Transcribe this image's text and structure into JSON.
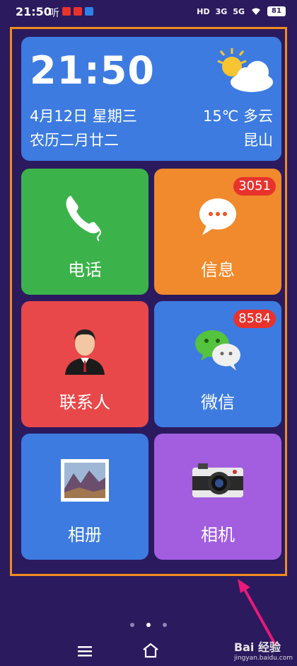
{
  "status_bar": {
    "time": "21:50",
    "app_label": "听",
    "net1": "HD",
    "net2": "3G",
    "net3": "5G",
    "battery": "81"
  },
  "widget": {
    "clock": "21:50",
    "date": "4月12日 星期三",
    "lunar": "农历二月廿二",
    "weather": "15℃ 多云",
    "city": "昆山",
    "weather_icon": "partly-cloudy-icon"
  },
  "tiles": [
    {
      "label": "电话",
      "icon": "phone-icon"
    },
    {
      "label": "信息",
      "icon": "message-icon",
      "badge": "3051"
    },
    {
      "label": "联系人",
      "icon": "contact-icon"
    },
    {
      "label": "微信",
      "icon": "wechat-icon",
      "badge": "8584"
    },
    {
      "label": "相册",
      "icon": "photo-album-icon"
    },
    {
      "label": "相机",
      "icon": "camera-icon"
    }
  ],
  "pager": {
    "count": 3,
    "active_index": 1
  },
  "watermark": {
    "brand": "Bai 经验",
    "url": "jingyan.baidu.com"
  },
  "colors": {
    "background": "#2b1a5e",
    "highlight_frame": "#f28b1e",
    "arrow": "#e8197a",
    "badge": "#e8332c"
  }
}
